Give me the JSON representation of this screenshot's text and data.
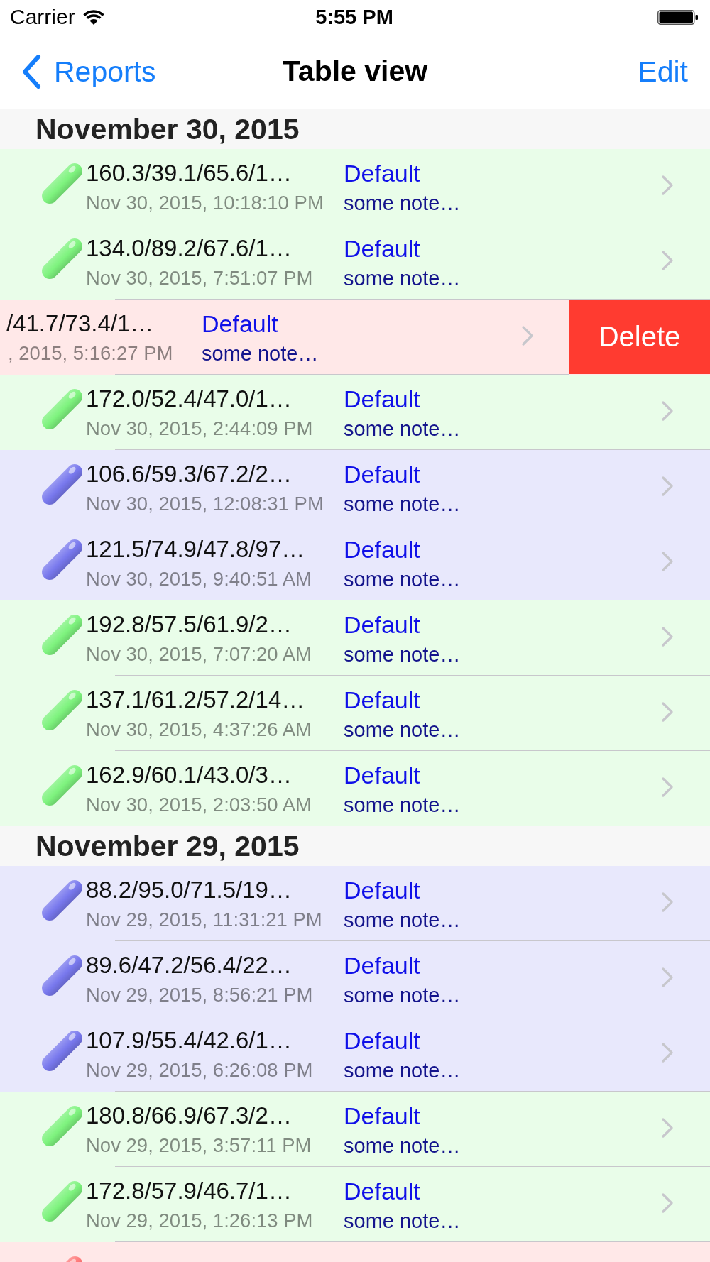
{
  "status_bar": {
    "carrier": "Carrier",
    "time": "5:55 PM"
  },
  "nav_bar": {
    "back_label": "Reports",
    "title": "Table view",
    "action": "Edit"
  },
  "sections": [
    {
      "header": "November 30, 2015",
      "rows": [
        {
          "values": "160.3/39.1/65.6/1…",
          "timestamp": "Nov 30, 2015, 10:18:10 PM",
          "profile": "Default",
          "note": "some note…",
          "color": "#e9fde9",
          "swiped": false
        },
        {
          "values": "134.0/89.2/67.6/1…",
          "timestamp": "Nov 30, 2015, 7:51:07 PM",
          "profile": "Default",
          "note": "some note…",
          "color": "#e9fde9",
          "swiped": false
        },
        {
          "values": "/41.7/73.4/1…",
          "timestamp": ", 2015, 5:16:27 PM",
          "profile": "Default",
          "note": "some note…",
          "color": "#ffe8e8",
          "swiped": true,
          "delete_label": "Delete"
        },
        {
          "values": "172.0/52.4/47.0/1…",
          "timestamp": "Nov 30, 2015, 2:44:09 PM",
          "profile": "Default",
          "note": "some note…",
          "color": "#e9fde9",
          "swiped": false
        },
        {
          "values": "106.6/59.3/67.2/2…",
          "timestamp": "Nov 30, 2015, 12:08:31 PM",
          "profile": "Default",
          "note": "some note…",
          "color": "#e8e8fc",
          "swiped": false
        },
        {
          "values": "121.5/74.9/47.8/97…",
          "timestamp": "Nov 30, 2015, 9:40:51 AM",
          "profile": "Default",
          "note": "some note…",
          "color": "#e8e8fc",
          "swiped": false
        },
        {
          "values": "192.8/57.5/61.9/2…",
          "timestamp": "Nov 30, 2015, 7:07:20 AM",
          "profile": "Default",
          "note": "some note…",
          "color": "#e9fde9",
          "swiped": false
        },
        {
          "values": "137.1/61.2/57.2/14…",
          "timestamp": "Nov 30, 2015, 4:37:26 AM",
          "profile": "Default",
          "note": "some note…",
          "color": "#e9fde9",
          "swiped": false
        },
        {
          "values": "162.9/60.1/43.0/3…",
          "timestamp": "Nov 30, 2015, 2:03:50 AM",
          "profile": "Default",
          "note": "some note…",
          "color": "#e9fde9",
          "swiped": false
        }
      ]
    },
    {
      "header": "November 29, 2015",
      "rows": [
        {
          "values": "88.2/95.0/71.5/19…",
          "timestamp": "Nov 29, 2015, 11:31:21 PM",
          "profile": "Default",
          "note": "some note…",
          "color": "#e8e8fc",
          "swiped": false
        },
        {
          "values": "89.6/47.2/56.4/22…",
          "timestamp": "Nov 29, 2015, 8:56:21 PM",
          "profile": "Default",
          "note": "some note…",
          "color": "#e8e8fc",
          "swiped": false
        },
        {
          "values": "107.9/55.4/42.6/1…",
          "timestamp": "Nov 29, 2015, 6:26:08 PM",
          "profile": "Default",
          "note": "some note…",
          "color": "#e8e8fc",
          "swiped": false
        },
        {
          "values": "180.8/66.9/67.3/2…",
          "timestamp": "Nov 29, 2015, 3:57:11 PM",
          "profile": "Default",
          "note": "some note…",
          "color": "#e9fde9",
          "swiped": false
        },
        {
          "values": "172.8/57.9/46.7/1…",
          "timestamp": "Nov 29, 2015, 1:26:13 PM",
          "profile": "Default",
          "note": "some note…",
          "color": "#e9fde9",
          "swiped": false
        },
        {
          "color": "#ffe8e8",
          "swiped": false
        }
      ]
    }
  ]
}
